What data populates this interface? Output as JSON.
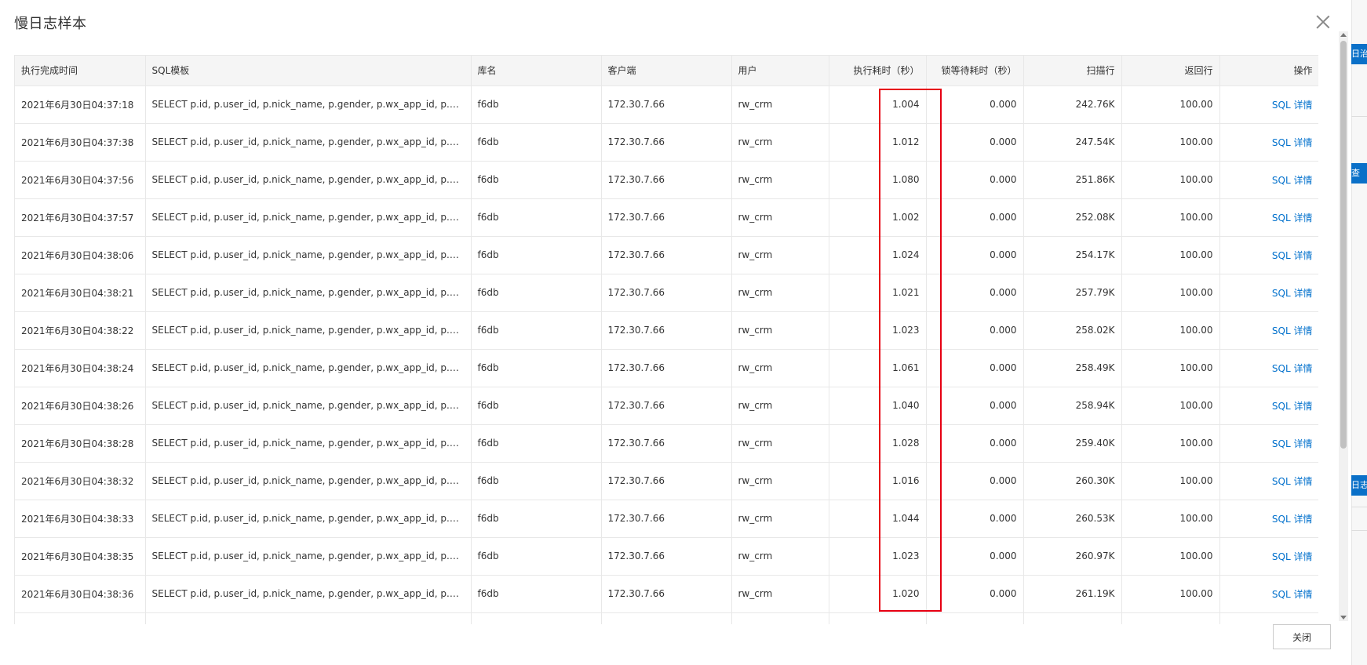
{
  "dialog": {
    "title": "慢日志样本",
    "close_label": "关闭"
  },
  "table": {
    "columns": [
      "执行完成时间",
      "SQL模板",
      "库名",
      "客户端",
      "用户",
      "执行耗时（秒）",
      "锁等待耗时（秒）",
      "扫描行",
      "返回行",
      "操作"
    ],
    "rows": [
      {
        "time": "2021年6月30日04:37:18",
        "sql": "SELECT p.id, p.user_id, p.nick_name, p.gender, p.wx_app_id, p.user_ty...",
        "db": "f6db",
        "client": "172.30.7.66",
        "user": "rw_crm",
        "exec": "1.004",
        "lock": "0.000",
        "scan": "242.76K",
        "ret": "100.00",
        "action": "SQL 详情"
      },
      {
        "time": "2021年6月30日04:37:38",
        "sql": "SELECT p.id, p.user_id, p.nick_name, p.gender, p.wx_app_id, p.user_ty...",
        "db": "f6db",
        "client": "172.30.7.66",
        "user": "rw_crm",
        "exec": "1.012",
        "lock": "0.000",
        "scan": "247.54K",
        "ret": "100.00",
        "action": "SQL 详情"
      },
      {
        "time": "2021年6月30日04:37:56",
        "sql": "SELECT p.id, p.user_id, p.nick_name, p.gender, p.wx_app_id, p.user_ty...",
        "db": "f6db",
        "client": "172.30.7.66",
        "user": "rw_crm",
        "exec": "1.080",
        "lock": "0.000",
        "scan": "251.86K",
        "ret": "100.00",
        "action": "SQL 详情"
      },
      {
        "time": "2021年6月30日04:37:57",
        "sql": "SELECT p.id, p.user_id, p.nick_name, p.gender, p.wx_app_id, p.user_ty...",
        "db": "f6db",
        "client": "172.30.7.66",
        "user": "rw_crm",
        "exec": "1.002",
        "lock": "0.000",
        "scan": "252.08K",
        "ret": "100.00",
        "action": "SQL 详情"
      },
      {
        "time": "2021年6月30日04:38:06",
        "sql": "SELECT p.id, p.user_id, p.nick_name, p.gender, p.wx_app_id, p.user_ty...",
        "db": "f6db",
        "client": "172.30.7.66",
        "user": "rw_crm",
        "exec": "1.024",
        "lock": "0.000",
        "scan": "254.17K",
        "ret": "100.00",
        "action": "SQL 详情"
      },
      {
        "time": "2021年6月30日04:38:21",
        "sql": "SELECT p.id, p.user_id, p.nick_name, p.gender, p.wx_app_id, p.user_ty...",
        "db": "f6db",
        "client": "172.30.7.66",
        "user": "rw_crm",
        "exec": "1.021",
        "lock": "0.000",
        "scan": "257.79K",
        "ret": "100.00",
        "action": "SQL 详情"
      },
      {
        "time": "2021年6月30日04:38:22",
        "sql": "SELECT p.id, p.user_id, p.nick_name, p.gender, p.wx_app_id, p.user_ty...",
        "db": "f6db",
        "client": "172.30.7.66",
        "user": "rw_crm",
        "exec": "1.023",
        "lock": "0.000",
        "scan": "258.02K",
        "ret": "100.00",
        "action": "SQL 详情"
      },
      {
        "time": "2021年6月30日04:38:24",
        "sql": "SELECT p.id, p.user_id, p.nick_name, p.gender, p.wx_app_id, p.user_ty...",
        "db": "f6db",
        "client": "172.30.7.66",
        "user": "rw_crm",
        "exec": "1.061",
        "lock": "0.000",
        "scan": "258.49K",
        "ret": "100.00",
        "action": "SQL 详情"
      },
      {
        "time": "2021年6月30日04:38:26",
        "sql": "SELECT p.id, p.user_id, p.nick_name, p.gender, p.wx_app_id, p.user_ty...",
        "db": "f6db",
        "client": "172.30.7.66",
        "user": "rw_crm",
        "exec": "1.040",
        "lock": "0.000",
        "scan": "258.94K",
        "ret": "100.00",
        "action": "SQL 详情"
      },
      {
        "time": "2021年6月30日04:38:28",
        "sql": "SELECT p.id, p.user_id, p.nick_name, p.gender, p.wx_app_id, p.user_ty...",
        "db": "f6db",
        "client": "172.30.7.66",
        "user": "rw_crm",
        "exec": "1.028",
        "lock": "0.000",
        "scan": "259.40K",
        "ret": "100.00",
        "action": "SQL 详情"
      },
      {
        "time": "2021年6月30日04:38:32",
        "sql": "SELECT p.id, p.user_id, p.nick_name, p.gender, p.wx_app_id, p.user_ty...",
        "db": "f6db",
        "client": "172.30.7.66",
        "user": "rw_crm",
        "exec": "1.016",
        "lock": "0.000",
        "scan": "260.30K",
        "ret": "100.00",
        "action": "SQL 详情"
      },
      {
        "time": "2021年6月30日04:38:33",
        "sql": "SELECT p.id, p.user_id, p.nick_name, p.gender, p.wx_app_id, p.user_ty...",
        "db": "f6db",
        "client": "172.30.7.66",
        "user": "rw_crm",
        "exec": "1.044",
        "lock": "0.000",
        "scan": "260.53K",
        "ret": "100.00",
        "action": "SQL 详情"
      },
      {
        "time": "2021年6月30日04:38:35",
        "sql": "SELECT p.id, p.user_id, p.nick_name, p.gender, p.wx_app_id, p.user_ty...",
        "db": "f6db",
        "client": "172.30.7.66",
        "user": "rw_crm",
        "exec": "1.023",
        "lock": "0.000",
        "scan": "260.97K",
        "ret": "100.00",
        "action": "SQL 详情"
      },
      {
        "time": "2021年6月30日04:38:36",
        "sql": "SELECT p.id, p.user_id, p.nick_name, p.gender, p.wx_app_id, p.user_ty...",
        "db": "f6db",
        "client": "172.30.7.66",
        "user": "rw_crm",
        "exec": "1.020",
        "lock": "0.000",
        "scan": "261.19K",
        "ret": "100.00",
        "action": "SQL 详情"
      },
      {
        "time": "",
        "sql": "",
        "db": "",
        "client": "",
        "user": "",
        "exec": "",
        "lock": "",
        "scan": "",
        "ret": "",
        "action": ""
      }
    ]
  },
  "background": {
    "tags": [
      "日治",
      "查",
      "日志"
    ]
  },
  "colors": {
    "link": "#0070cc",
    "highlight": "#e60012",
    "header_bg": "#f5f5f5"
  }
}
